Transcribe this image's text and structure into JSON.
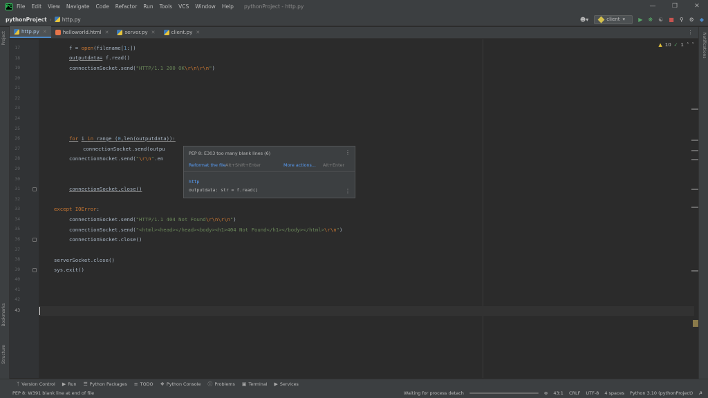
{
  "menubar": {
    "items": [
      "File",
      "Edit",
      "View",
      "Navigate",
      "Code",
      "Refactor",
      "Run",
      "Tools",
      "VCS",
      "Window",
      "Help"
    ],
    "window_title": "pythonProject - http.py"
  },
  "navbar": {
    "project": "pythonProject",
    "file": "http.py",
    "run_config": "client"
  },
  "tabs": [
    {
      "label": "http.py",
      "active": true
    },
    {
      "label": "helloworld.html",
      "active": false
    },
    {
      "label": "server.py",
      "active": false
    },
    {
      "label": "client.py",
      "active": false
    }
  ],
  "side_labels": {
    "project": "Project",
    "bookmarks": "Bookmarks",
    "structure": "Structure",
    "notifications": "Notifications"
  },
  "inspections": {
    "warnings": "10",
    "ok": "1"
  },
  "editor": {
    "line_numbers": [
      "17",
      "18",
      "19",
      "20",
      "21",
      "22",
      "23",
      "24",
      "25",
      "26",
      "27",
      "28",
      "29",
      "30",
      "31",
      "32",
      "33",
      "34",
      "35",
      "36",
      "37",
      "38",
      "39",
      "40",
      "41",
      "42",
      "43"
    ],
    "current_line": "43"
  },
  "popup": {
    "message": "PEP 8: E303 too many blank lines (6)",
    "action1": "Reformat the file",
    "shortcut1": "Alt+Shift+Enter",
    "action2": "More actions...",
    "shortcut2": "Alt+Enter",
    "module": "http",
    "signature": "outputdata: str = f.read()"
  },
  "tool_windows": [
    "Version Control",
    "Run",
    "Python Packages",
    "TODO",
    "Python Console",
    "Problems",
    "Terminal",
    "Services"
  ],
  "statusbar": {
    "message": "PEP 8: W391 blank line at end of file",
    "process": "Waiting for process detach",
    "position": "43:1",
    "line_sep": "CRLF",
    "encoding": "UTF-8",
    "indent": "4 spaces",
    "interpreter": "Python 3.10 (pythonProject)"
  }
}
